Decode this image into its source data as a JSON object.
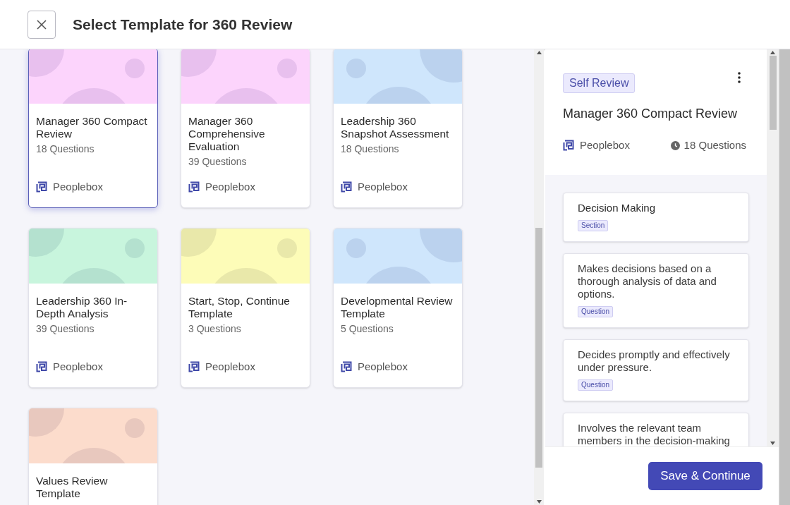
{
  "header": {
    "title": "Select Template for 360 Review"
  },
  "templates": [
    {
      "title": "Manager 360 Compact Review",
      "questions": "18 Questions",
      "publisher": "Peoplebox",
      "color": "#fcd4fc",
      "selected": true
    },
    {
      "title": "Manager 360 Comprehensive Evaluation",
      "questions": "39 Questions",
      "publisher": "Peoplebox",
      "color": "#fcd4fc",
      "selected": false
    },
    {
      "title": "Leadership 360 Snapshot Assessment",
      "questions": "18 Questions",
      "publisher": "Peoplebox",
      "color": "#cfe6fc",
      "selected": false
    },
    {
      "title": "Leadership 360 In-Depth Analysis",
      "questions": "39 Questions",
      "publisher": "Peoplebox",
      "color": "#c8f5dd",
      "selected": false
    },
    {
      "title": "Start, Stop, Continue Template",
      "questions": "3 Questions",
      "publisher": "Peoplebox",
      "color": "#fdfcb8",
      "selected": false
    },
    {
      "title": "Developmental Review Template",
      "questions": "5 Questions",
      "publisher": "Peoplebox",
      "color": "#cfe6fc",
      "selected": false
    },
    {
      "title": "Values Review Template",
      "color": "#fcdccc",
      "selected": false
    }
  ],
  "preview": {
    "badge": "Self Review",
    "title": "Manager 360 Compact Review",
    "publisher": "Peoplebox",
    "questions": "18 Questions",
    "items": [
      {
        "kind": "section",
        "text": "Decision Making",
        "tag": "Section"
      },
      {
        "kind": "question",
        "text": "Makes decisions based on a thorough analysis of data and options.",
        "tag": "Question"
      },
      {
        "kind": "question",
        "text": "Decides promptly and effectively under pressure.",
        "tag": "Question"
      },
      {
        "kind": "question",
        "text": "Involves the relevant team members in the decision-making"
      }
    ]
  },
  "save_button": "Save & Continue"
}
